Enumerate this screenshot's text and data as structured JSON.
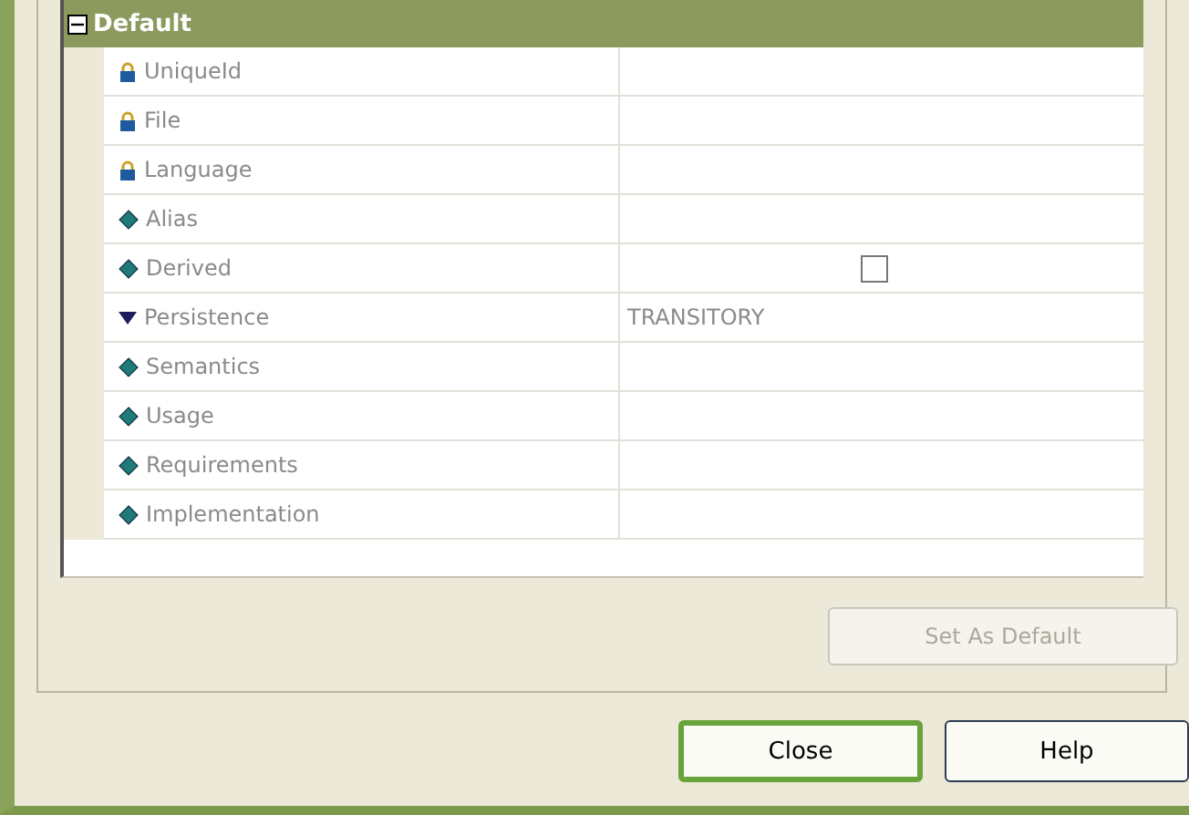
{
  "group": {
    "title": "Default",
    "expanded": true
  },
  "properties": [
    {
      "name": "UniqueId",
      "kind": "locked"
    },
    {
      "name": "File",
      "kind": "locked"
    },
    {
      "name": "Language",
      "kind": "locked"
    },
    {
      "name": "Alias",
      "kind": "property"
    },
    {
      "name": "Derived",
      "kind": "property",
      "checked": false
    },
    {
      "name": "Persistence",
      "kind": "enum",
      "value": "TRANSITORY"
    },
    {
      "name": "Semantics",
      "kind": "property"
    },
    {
      "name": "Usage",
      "kind": "property"
    },
    {
      "name": "Requirements",
      "kind": "property"
    },
    {
      "name": "Implementation",
      "kind": "property"
    }
  ],
  "set_default_button": {
    "label": "Set As Default",
    "disabled": true
  },
  "buttons": [
    {
      "label": "Close",
      "default": true
    },
    {
      "label": "Help",
      "default": false
    }
  ]
}
